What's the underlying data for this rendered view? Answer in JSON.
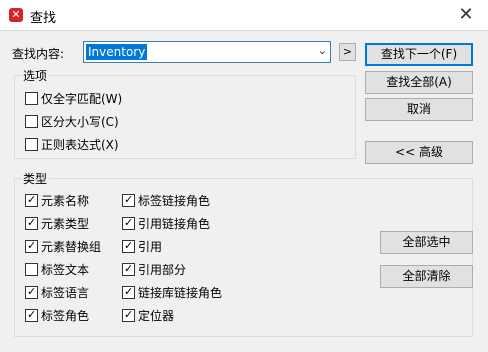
{
  "window": {
    "title": "查找",
    "close_glyph": "✕",
    "app_icon_glyph": "✕"
  },
  "search": {
    "label": "查找内容:",
    "value": "Inventory",
    "dropdown_glyph": "⌄",
    "expand_glyph": ">"
  },
  "buttons": {
    "find_next": "查找下一个(F)",
    "find_all": "查找全部(A)",
    "cancel": "取消",
    "advanced": "<< 高级",
    "select_all": "全部选中",
    "clear_all": "全部清除"
  },
  "options": {
    "title": "选项",
    "items": [
      {
        "label": "仅全字匹配(W)",
        "checked": false
      },
      {
        "label": "区分大小写(C)",
        "checked": false
      },
      {
        "label": "正则表达式(X)",
        "checked": false
      }
    ]
  },
  "types": {
    "title": "类型",
    "col1": [
      {
        "label": "元素名称",
        "checked": true
      },
      {
        "label": "元素类型",
        "checked": true
      },
      {
        "label": "元素替换组",
        "checked": true
      },
      {
        "label": "标签文本",
        "checked": false
      },
      {
        "label": "标签语言",
        "checked": true
      },
      {
        "label": "标签角色",
        "checked": true
      }
    ],
    "col2": [
      {
        "label": "标签链接角色",
        "checked": true
      },
      {
        "label": "引用链接角色",
        "checked": true
      },
      {
        "label": "引用",
        "checked": true
      },
      {
        "label": "引用部分",
        "checked": true
      },
      {
        "label": "链接库链接角色",
        "checked": true
      },
      {
        "label": "定位器",
        "checked": true
      }
    ]
  },
  "check_glyph": "✓"
}
